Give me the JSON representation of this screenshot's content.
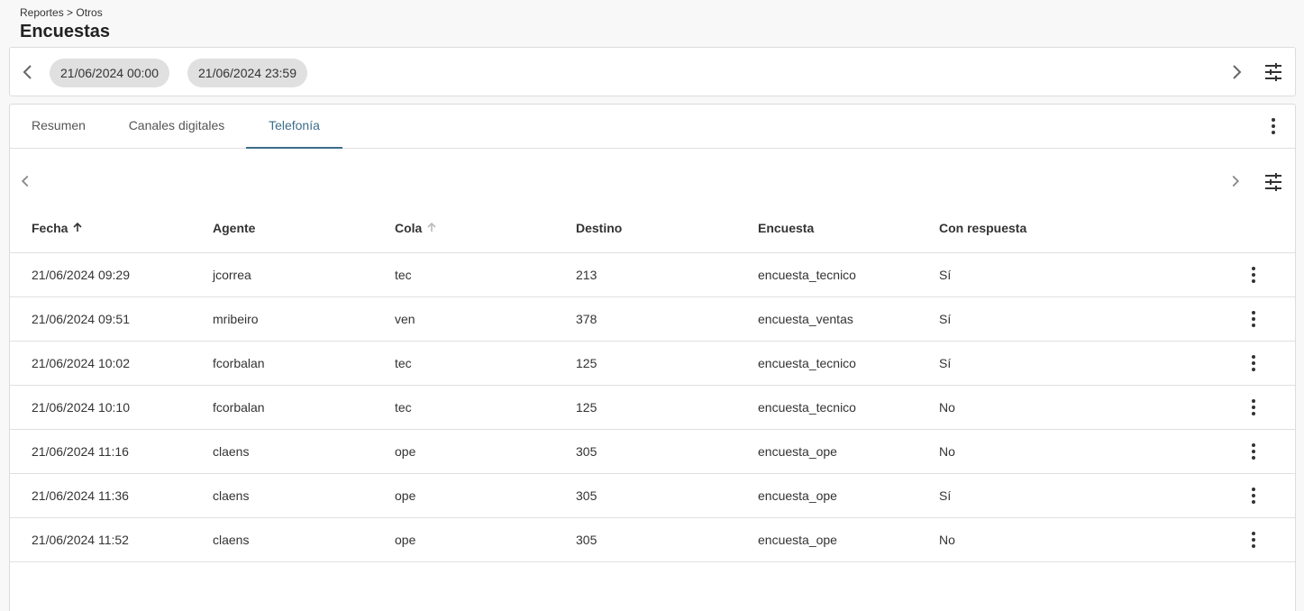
{
  "header": {
    "breadcrumb": "Reportes > Otros",
    "title": "Encuestas"
  },
  "filters": {
    "date_from": "21/06/2024 00:00",
    "date_to": "21/06/2024 23:59"
  },
  "tabs": [
    {
      "label": "Resumen",
      "active": false
    },
    {
      "label": "Canales digitales",
      "active": false
    },
    {
      "label": "Telefonía",
      "active": true
    }
  ],
  "table": {
    "columns": [
      "Fecha",
      "Agente",
      "Cola",
      "Destino",
      "Encuesta",
      "Con respuesta"
    ],
    "rows": [
      [
        "21/06/2024 09:29",
        "jcorrea",
        "tec",
        "213",
        "encuesta_tecnico",
        "Sí"
      ],
      [
        "21/06/2024 09:51",
        "mribeiro",
        "ven",
        "378",
        "encuesta_ventas",
        "Sí"
      ],
      [
        "21/06/2024 10:02",
        "fcorbalan",
        "tec",
        "125",
        "encuesta_tecnico",
        "Sí"
      ],
      [
        "21/06/2024 10:10",
        "fcorbalan",
        "tec",
        "125",
        "encuesta_tecnico",
        "No"
      ],
      [
        "21/06/2024 11:16",
        "claens",
        "ope",
        "305",
        "encuesta_ope",
        "No"
      ],
      [
        "21/06/2024 11:36",
        "claens",
        "ope",
        "305",
        "encuesta_ope",
        "Sí"
      ],
      [
        "21/06/2024 11:52",
        "claens",
        "ope",
        "305",
        "encuesta_ope",
        "No"
      ]
    ]
  },
  "colors": {
    "accent": "#3d6d8a",
    "chip_bg": "#e0e0e0",
    "border": "#e0e0e0"
  }
}
